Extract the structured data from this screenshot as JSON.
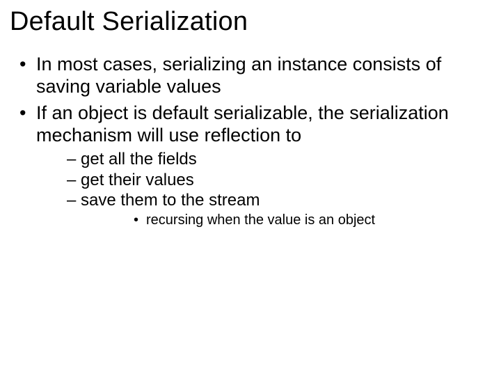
{
  "title": "Default Serialization",
  "bullets": [
    {
      "text": "In most cases, serializing an instance consists of saving variable values"
    },
    {
      "text": "If an object is default serializable, the serialization mechanism will use reflection to",
      "children": [
        {
          "text": "get all the fields"
        },
        {
          "text": "get their values"
        },
        {
          "text": "save them to the stream",
          "children": [
            {
              "text": "recursing when the value is an object"
            }
          ]
        }
      ]
    }
  ]
}
